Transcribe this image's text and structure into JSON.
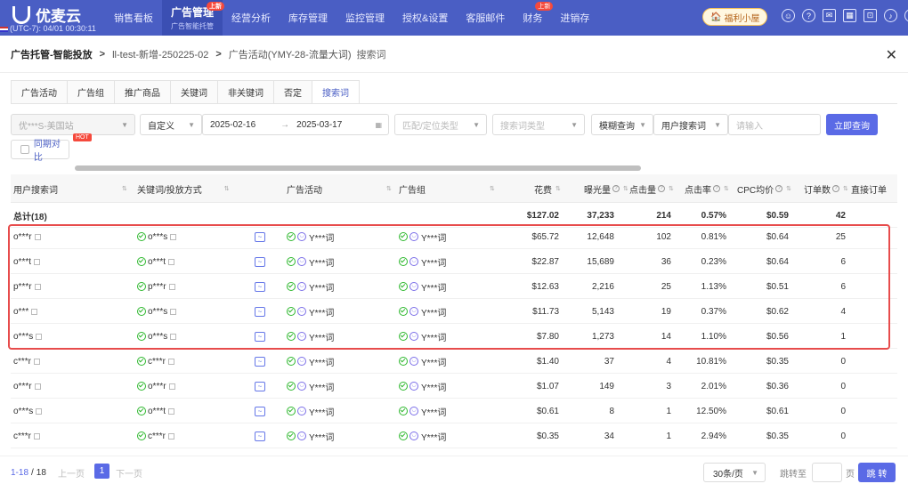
{
  "app": {
    "logo_text": "优麦云",
    "timezone_text": "(UTC-7): 04/01 00:30:11",
    "nav": [
      {
        "label": "销售看板"
      },
      {
        "label": "广告管理",
        "sub": "广告智能托管",
        "badge": "上新"
      },
      {
        "label": "经营分析"
      },
      {
        "label": "库存管理"
      },
      {
        "label": "监控管理"
      },
      {
        "label": "授权&设置"
      },
      {
        "label": "客服邮件"
      },
      {
        "label": "财务",
        "badge": "上新"
      },
      {
        "label": "进销存"
      }
    ],
    "welfare": "福利小屋"
  },
  "breadcrumb": {
    "main": "广告托管-智能投放",
    "level2": "ll-test-新增-250225-02",
    "level3": "广告活动(YMY-28-流量大词)",
    "current": "搜索词"
  },
  "tabs": [
    "广告活动",
    "广告组",
    "推广商品",
    "关键词",
    "非关键词",
    "否定",
    "搜索词"
  ],
  "active_tab": "搜索词",
  "filters": {
    "store": "优***S-美国站",
    "date_mode": "自定义",
    "start_date": "2025-02-16",
    "end_date": "2025-03-17",
    "match_type_placeholder": "匹配/定位类型",
    "term_type_placeholder": "搜索词类型",
    "query_mode": "模糊查询",
    "field": "用户搜索词",
    "input_placeholder": "请输入",
    "query_button": "立即查询",
    "compare_label": "同期对比",
    "hot_badge": "HOT"
  },
  "table": {
    "headers": {
      "term": "用户搜索词",
      "keyword": "关键词/投放方式",
      "campaign": "广告活动",
      "group": "广告组",
      "spend": "花费",
      "impressions": "曝光量",
      "clicks": "点击量",
      "ctr": "点击率",
      "cpc": "CPC均价",
      "orders": "订单数",
      "direct": "直接订单"
    },
    "total": {
      "label": "总计(18)",
      "spend": "$127.02",
      "impressions": "37,233",
      "clicks": "214",
      "ctr": "0.57%",
      "cpc": "$0.59",
      "orders": "42"
    },
    "rows": [
      {
        "term": "o***r",
        "keyword": "o***s",
        "campaign": "Y***词",
        "group": "Y***词",
        "spend": "$65.72",
        "impressions": "12,648",
        "clicks": "102",
        "ctr": "0.81%",
        "cpc": "$0.64",
        "orders": "25"
      },
      {
        "term": "o***t",
        "keyword": "o***t",
        "campaign": "Y***词",
        "group": "Y***词",
        "spend": "$22.87",
        "impressions": "15,689",
        "clicks": "36",
        "ctr": "0.23%",
        "cpc": "$0.64",
        "orders": "6"
      },
      {
        "term": "p***r",
        "keyword": "p***r",
        "campaign": "Y***词",
        "group": "Y***词",
        "spend": "$12.63",
        "impressions": "2,216",
        "clicks": "25",
        "ctr": "1.13%",
        "cpc": "$0.51",
        "orders": "6"
      },
      {
        "term": "o***",
        "keyword": "o***s",
        "campaign": "Y***词",
        "group": "Y***词",
        "spend": "$11.73",
        "impressions": "5,143",
        "clicks": "19",
        "ctr": "0.37%",
        "cpc": "$0.62",
        "orders": "4"
      },
      {
        "term": "o***s",
        "keyword": "o***s",
        "campaign": "Y***词",
        "group": "Y***词",
        "spend": "$7.80",
        "impressions": "1,273",
        "clicks": "14",
        "ctr": "1.10%",
        "cpc": "$0.56",
        "orders": "1"
      },
      {
        "term": "c***r",
        "keyword": "c***r",
        "campaign": "Y***词",
        "group": "Y***词",
        "spend": "$1.40",
        "impressions": "37",
        "clicks": "4",
        "ctr": "10.81%",
        "cpc": "$0.35",
        "orders": "0"
      },
      {
        "term": "o***r",
        "keyword": "o***r",
        "campaign": "Y***词",
        "group": "Y***词",
        "spend": "$1.07",
        "impressions": "149",
        "clicks": "3",
        "ctr": "2.01%",
        "cpc": "$0.36",
        "orders": "0"
      },
      {
        "term": "o***s",
        "keyword": "o***t",
        "campaign": "Y***词",
        "group": "Y***词",
        "spend": "$0.61",
        "impressions": "8",
        "clicks": "1",
        "ctr": "12.50%",
        "cpc": "$0.61",
        "orders": "0"
      },
      {
        "term": "c***r",
        "keyword": "c***r",
        "campaign": "Y***词",
        "group": "Y***词",
        "spend": "$0.35",
        "impressions": "34",
        "clicks": "1",
        "ctr": "2.94%",
        "cpc": "$0.35",
        "orders": "0"
      }
    ]
  },
  "pagination": {
    "range": "1-18",
    "sep": "/",
    "total": "18",
    "prev": "上一页",
    "page": "1",
    "next": "下一页",
    "page_size": "30条/页",
    "jump_label": "跳转至",
    "page_unit": "页",
    "go": "跳 转"
  },
  "colors": {
    "brand": "#4a5ec4",
    "primary_button": "#5a6ae6",
    "highlight_border": "#e74c4c",
    "ok_icon": "#2eb82e"
  }
}
